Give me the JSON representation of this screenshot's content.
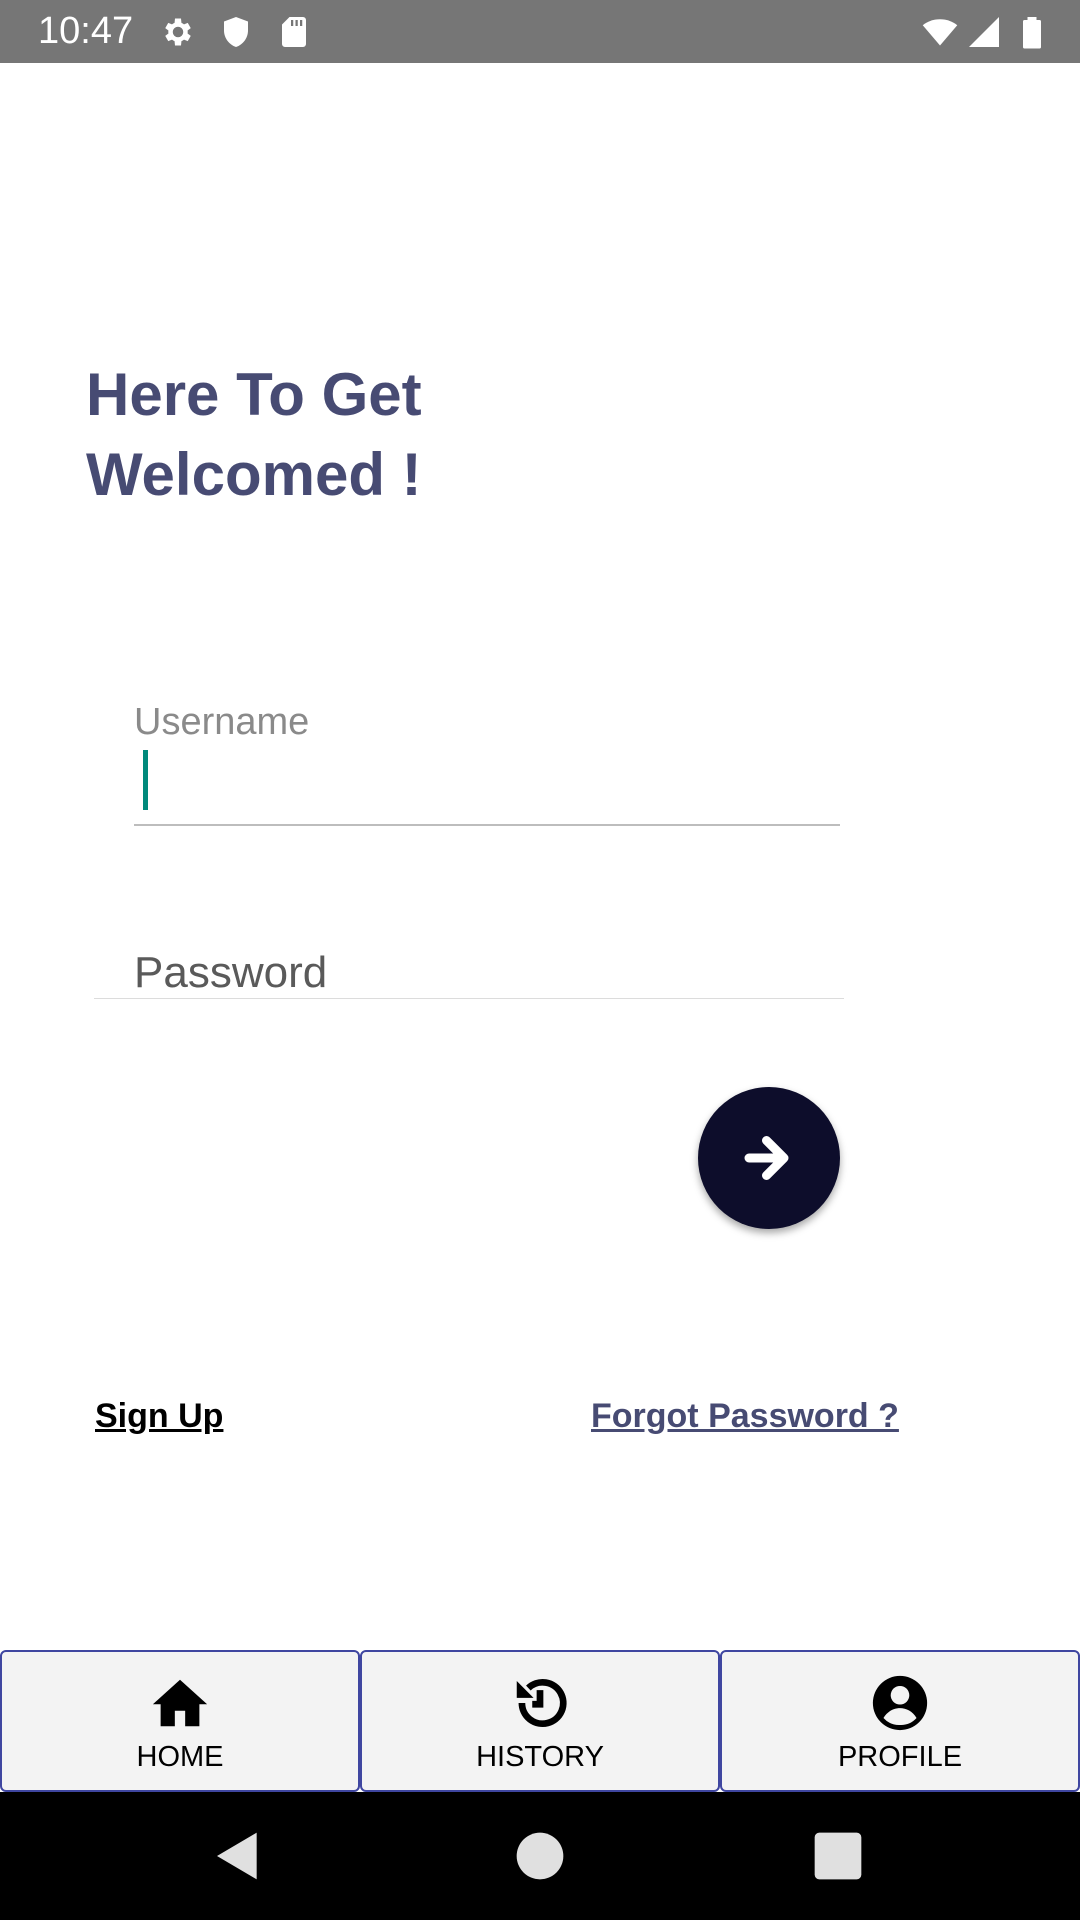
{
  "status_bar": {
    "time": "10:47",
    "icons": [
      "gear-icon",
      "shield-icon",
      "sd-card-icon",
      "wifi-icon",
      "signal-icon",
      "battery-icon"
    ]
  },
  "heading": {
    "line1": "Here To Get",
    "line2": "Welcomed !"
  },
  "form": {
    "username_label": "Username",
    "username_value": "",
    "password_placeholder": "Password",
    "submit_icon": "arrow-right-icon"
  },
  "links": {
    "signup": "Sign Up",
    "forgot": "Forgot Password ?"
  },
  "bottom_nav": {
    "items": [
      {
        "label": "HOME",
        "icon": "home-icon"
      },
      {
        "label": "HISTORY",
        "icon": "history-icon"
      },
      {
        "label": "PROFILE",
        "icon": "profile-icon"
      }
    ]
  },
  "system_nav": {
    "icons": [
      "back-icon",
      "home-circle-icon",
      "recents-icon"
    ]
  },
  "colors": {
    "heading": "#474b73",
    "accent_caret": "#00897b",
    "fab": "#0d0d2b",
    "nav_border": "#3f46a0",
    "status_bar": "#767676"
  }
}
